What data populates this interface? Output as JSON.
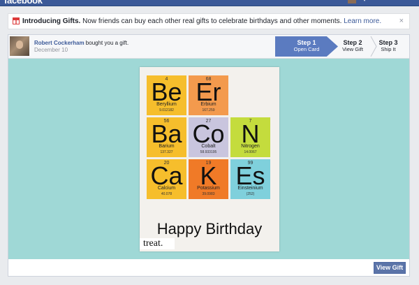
{
  "topbar": {
    "brand": "facebook"
  },
  "notice": {
    "title": "Introducing Gifts.",
    "body": " Now friends can buy each other real gifts to celebrate birthdays and other moments. ",
    "link": "Learn more.",
    "close": "×"
  },
  "gift": {
    "sender_name": "Robert Cockerham",
    "action": " bought you a gift.",
    "date": "December 10"
  },
  "steps": [
    {
      "title": "Step 1",
      "label": "Open Card",
      "active": true
    },
    {
      "title": "Step 2",
      "label": "View Gift",
      "active": false
    },
    {
      "title": "Step 3",
      "label": "Ship It",
      "active": false
    }
  ],
  "card": {
    "tiles": [
      {
        "number": "4",
        "symbol": "Be",
        "name": "Beryllium",
        "mass": "9.012182",
        "color": "#f6be2c"
      },
      {
        "number": "68",
        "symbol": "Er",
        "name": "Erbium",
        "mass": "167.259",
        "color": "#f39a4d"
      },
      {
        "number": "56",
        "symbol": "Ba",
        "name": "Barium",
        "mass": "137.327",
        "color": "#f6be2c"
      },
      {
        "number": "27",
        "symbol": "Co",
        "name": "Cobalt",
        "mass": "58.933195",
        "color": "#c9c5de"
      },
      {
        "number": "7",
        "symbol": "N",
        "name": "Nitrogen",
        "mass": "14.0067",
        "color": "#c4dc3d"
      },
      {
        "number": "20",
        "symbol": "Ca",
        "name": "Calcium",
        "mass": "40.078",
        "color": "#f6be2c"
      },
      {
        "number": "19",
        "symbol": "K",
        "name": "Potassium",
        "mass": "39.0983",
        "color": "#f07a27"
      },
      {
        "number": "99",
        "symbol": "Es",
        "name": "Einsteinium",
        "mass": "(252)",
        "color": "#7fd0dc"
      }
    ],
    "message": "Happy Birthday",
    "brand": "treat."
  },
  "footer": {
    "view_gift_label": "View Gift"
  },
  "colors": {
    "facebook_blue": "#3b5998",
    "stage_bg": "#9fd8d6",
    "step_active": "#5b7bc0"
  }
}
